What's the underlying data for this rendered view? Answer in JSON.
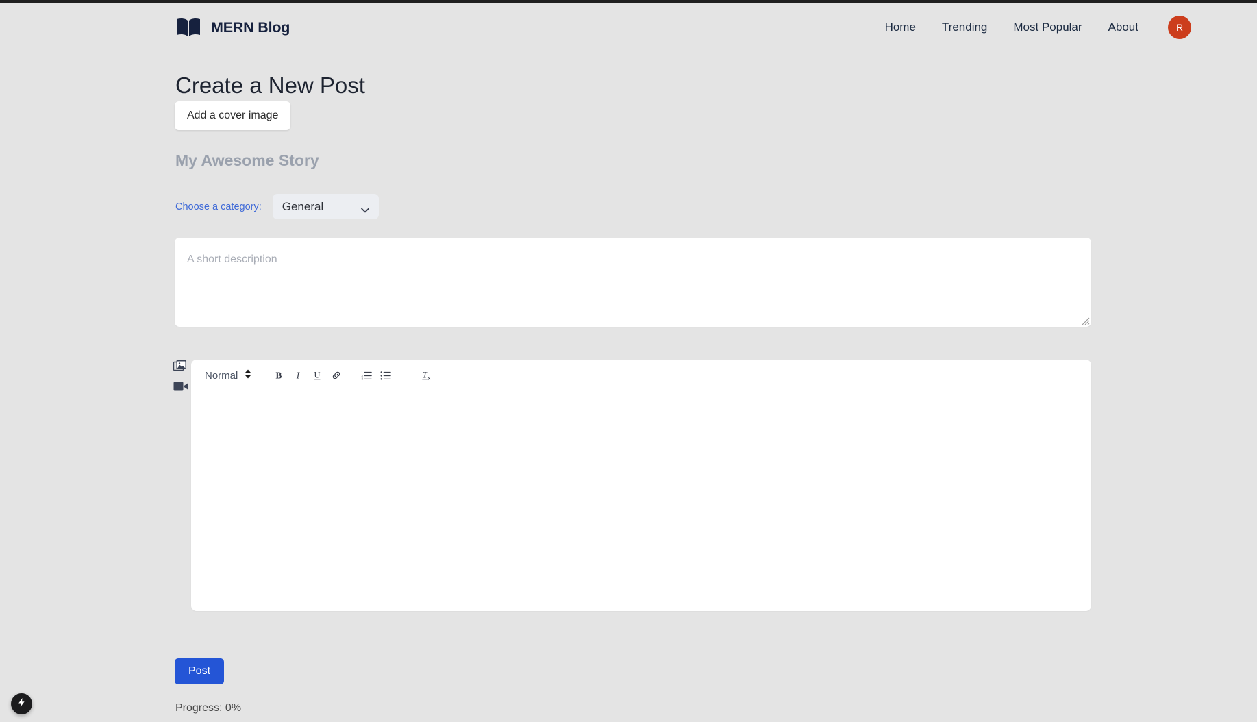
{
  "theme": {
    "page_bg": "#e4e4e4",
    "brand_navy": "#16213e",
    "accent_blue": "#3f6ad8",
    "post_button_blue": "#2455d6",
    "avatar_red": "#cc3d1c",
    "placeholder_gray": "#9aa1ad",
    "surface_white": "#ffffff",
    "select_bg": "#eceef2",
    "top_strip": "#1f1f1f"
  },
  "navbar": {
    "brand_icon": "open-book-icon",
    "brand_name": "MERN Blog",
    "links": [
      {
        "label": "Home"
      },
      {
        "label": "Trending"
      },
      {
        "label": "Most Popular"
      },
      {
        "label": "About"
      }
    ],
    "avatar": {
      "initial": "R"
    }
  },
  "main": {
    "page_title": "Create a New Post",
    "cover_image_button": "Add a cover image",
    "title_placeholder": "My Awesome Story",
    "category": {
      "label": "Choose a category:",
      "selected": "General",
      "options": [
        "General"
      ],
      "chevron_icon": "chevron-down-icon"
    },
    "description": {
      "placeholder": "A short description",
      "value": ""
    },
    "side_media": {
      "image_icon": "images-icon",
      "video_icon": "video-camera-icon"
    },
    "editor": {
      "format_select": "Normal",
      "format_icon": "up-down-arrows-icon",
      "buttons": [
        {
          "name": "bold",
          "glyph": "B"
        },
        {
          "name": "italic",
          "glyph": "I"
        },
        {
          "name": "underline",
          "glyph": "U"
        },
        {
          "name": "link",
          "glyph": "link-icon"
        },
        {
          "name": "ordered-list",
          "glyph": "ordered-list-icon"
        },
        {
          "name": "bullet-list",
          "glyph": "bullet-list-icon"
        },
        {
          "name": "clear-formatting",
          "glyph": "clear-format-icon"
        }
      ],
      "body_text": ""
    },
    "post_button": "Post",
    "progress": "Progress: 0%"
  },
  "fab": {
    "icon": "lightning-bolt-icon"
  }
}
